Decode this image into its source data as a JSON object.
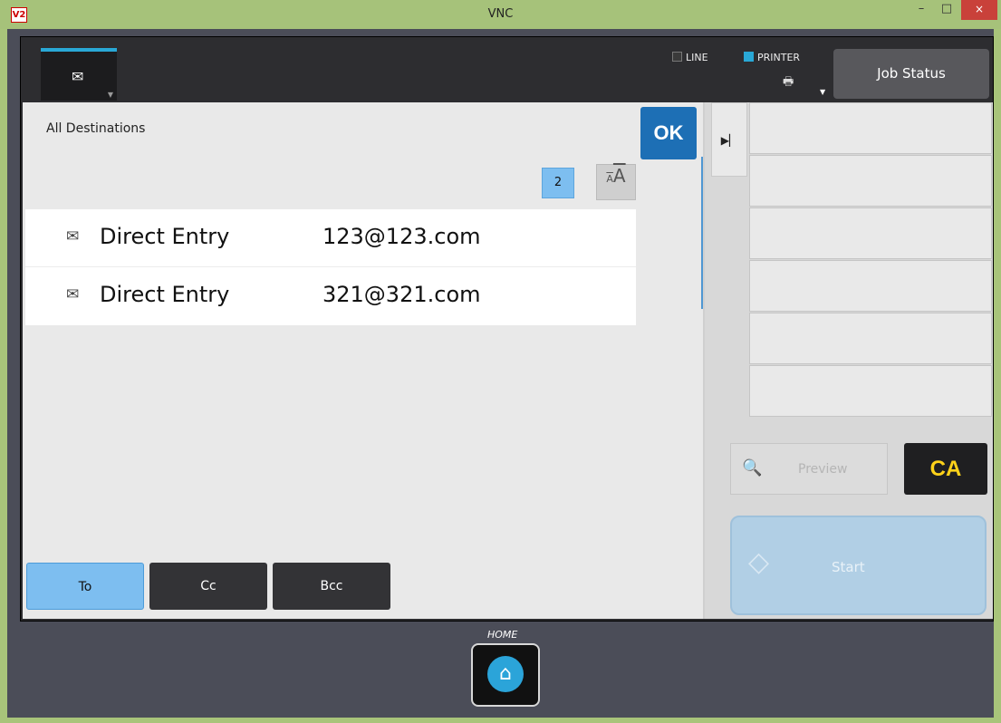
{
  "window": {
    "title": "VNC",
    "app_icon_text": "V2",
    "minimize": "–",
    "maximize": "□",
    "close": "×"
  },
  "topbar": {
    "mail_tab_icon": "envelope-icon",
    "line_label": "LINE",
    "printer_label": "PRINTER",
    "job_status_label": "Job Status"
  },
  "panel": {
    "title": "All Destinations",
    "ok_label": "OK",
    "count": "2",
    "font_toggle_small": "A",
    "font_toggle_big": "A",
    "entries": [
      {
        "type": "Direct Entry",
        "address": "123@123.com"
      },
      {
        "type": "Direct Entry",
        "address": "321@321.com"
      }
    ],
    "tabs": {
      "to": "To",
      "cc": "Cc",
      "bcc": "Bcc"
    }
  },
  "right": {
    "collapse_icon": "expand-right-icon",
    "preview_label": "Preview",
    "ca_label": "CA",
    "start_label": "Start"
  },
  "home": {
    "label": "HOME"
  },
  "colors": {
    "accent": "#29a8d6",
    "ok_button": "#1d6fb5",
    "selected_tab": "#7dbef0",
    "ca_text": "#ffd21a",
    "titlebar": "#a6c27a"
  }
}
